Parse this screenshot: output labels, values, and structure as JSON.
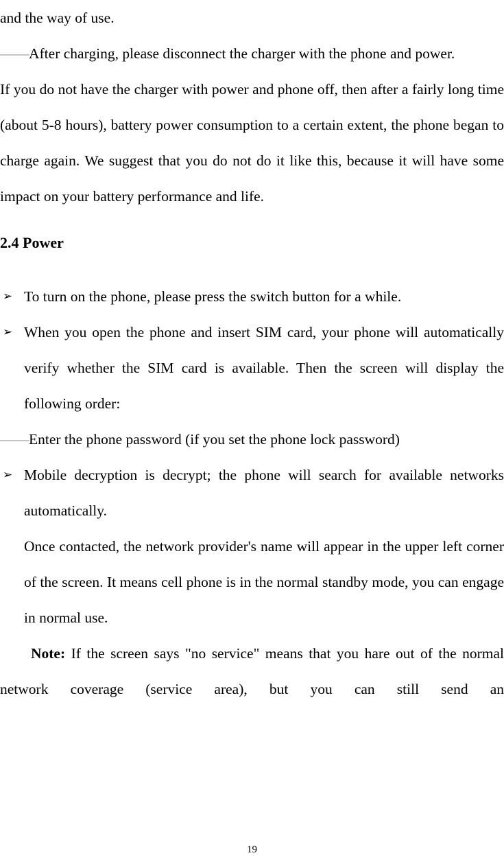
{
  "document": {
    "page_number": "19",
    "blocks": {
      "line_and_the_way_of_use": "and the way of use.",
      "dash_lead": "——",
      "after_charging": "After charging, please disconnect the charger with the phone and power.",
      "if_you_do_not_have": "If you do not have the charger with power and phone off, then after a fairly long time (about 5-8 hours), battery power consumption to a certain extent, the phone began to charge again. We suggest that you do not do it like this, because it will have some impact on your battery performance and life.",
      "heading_power": "2.4 Power",
      "bullet_marker": "➢",
      "bullet_turn_on": "To turn on the phone, please press the switch button for a while.",
      "bullet_when_you_open": "When you open the phone and insert SIM card, your phone will automatically verify whether the SIM card is available. Then the screen will display the following order:",
      "enter_password": "Enter the phone password (if you set the phone lock password)",
      "bullet_mobile_decryption": "Mobile decryption is decrypt; the phone will search for available networks automatically.",
      "once_contacted": "Once contacted, the network provider's name will appear in the upper left corner of the screen. It means cell phone is in the normal standby mode, you can engage in normal use.",
      "note_label": "Note:",
      "note_text": " If the screen says \"no service\" means that you hare out of the normal network coverage (service area), but you can still send an"
    }
  }
}
